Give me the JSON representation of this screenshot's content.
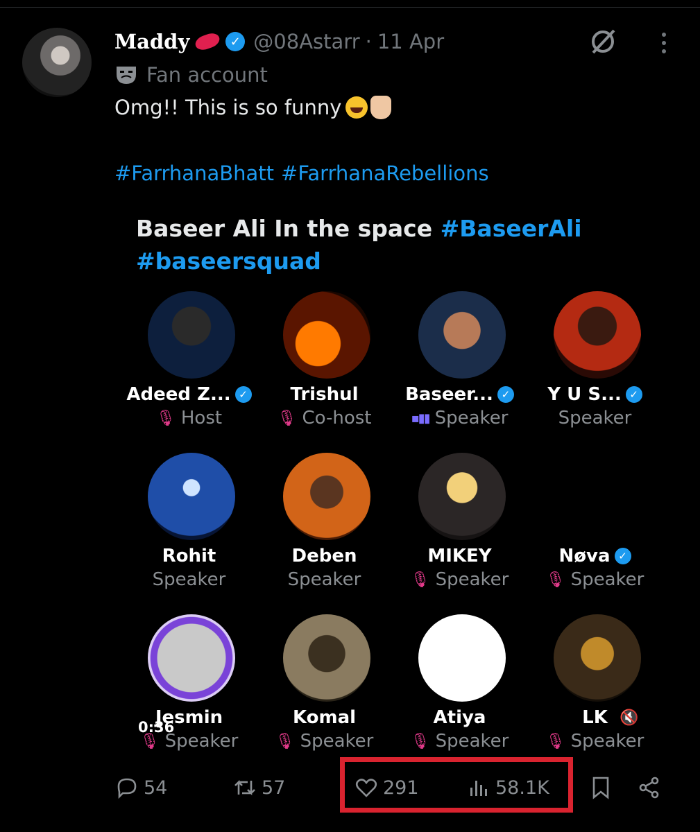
{
  "post": {
    "author_name": "Maddy",
    "handle": "@08Astarr",
    "separator": "·",
    "date": "11 Apr",
    "label": "Fan account",
    "text": "Omg!! This is so funny",
    "hashtags": [
      "#FarrhanaBhatt",
      "#FarrhanaRebellions"
    ]
  },
  "media": {
    "title_plain": "Baseer Ali In the space",
    "title_tag1": "#BaseerAli",
    "title_tag2": "#baseersquad",
    "video_time": "0:36",
    "participants": [
      {
        "name": "Adeed Z...",
        "role": "Host",
        "verified": true,
        "mic": "muted"
      },
      {
        "name": "Trishul",
        "role": "Co-host",
        "verified": false,
        "mic": "muted"
      },
      {
        "name": "Baseer...",
        "role": "Speaker",
        "verified": true,
        "mic": "speaking"
      },
      {
        "name": "Y U S...",
        "role": "Speaker",
        "verified": true,
        "mic": "none"
      },
      {
        "name": "Rohit",
        "role": "Speaker",
        "verified": false,
        "mic": "none"
      },
      {
        "name": "Deben",
        "role": "Speaker",
        "verified": false,
        "mic": "none"
      },
      {
        "name": "MIKEY",
        "role": "Speaker",
        "verified": false,
        "mic": "muted"
      },
      {
        "name": "Nøva",
        "role": "Speaker",
        "verified": true,
        "mic": "muted"
      },
      {
        "name": "Jesmin",
        "role": "Speaker",
        "verified": false,
        "mic": "muted"
      },
      {
        "name": "Komal",
        "role": "Speaker",
        "verified": false,
        "mic": "muted"
      },
      {
        "name": "Atiya",
        "role": "Speaker",
        "verified": false,
        "mic": "muted"
      },
      {
        "name": "LK",
        "role": "Speaker",
        "verified": false,
        "mic": "muted"
      }
    ]
  },
  "actions": {
    "replies": "54",
    "reposts": "57",
    "likes": "291",
    "views": "58.1K"
  },
  "colors": {
    "accent": "#1d9bf0",
    "highlight": "#d9232f",
    "muted_mic": "#e23a8a"
  }
}
